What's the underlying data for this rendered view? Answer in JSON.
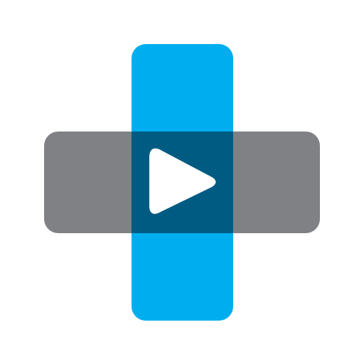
{
  "app_icon": {
    "icon": "medical-cross-play-icon",
    "colors": {
      "background": "#ffffff",
      "vertical_bar": "#00aeef",
      "horizontal_bar": "#808184",
      "overlap": "#005b82",
      "play_triangle": "#ffffff"
    }
  }
}
